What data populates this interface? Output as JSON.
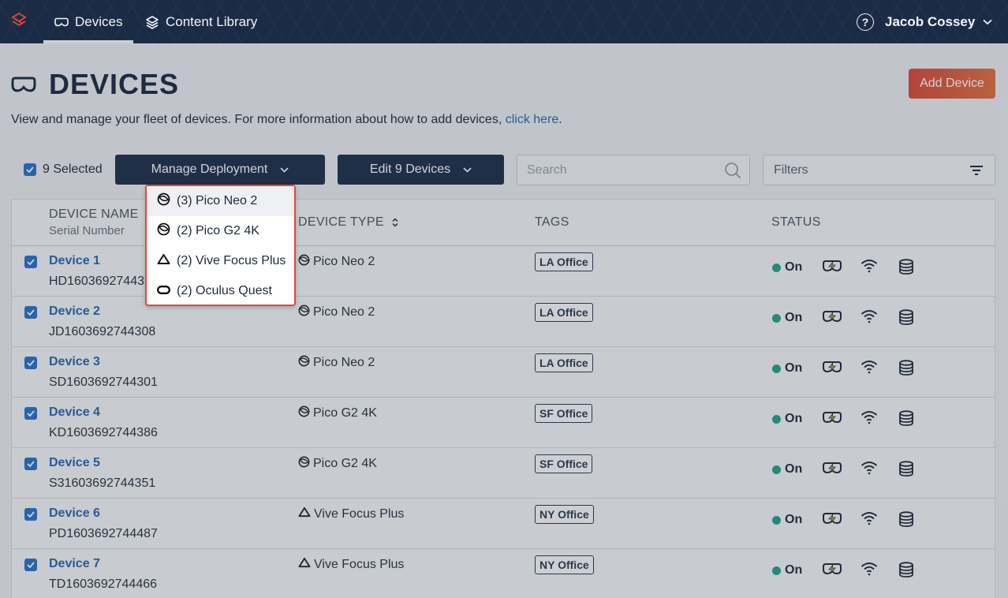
{
  "nav": {
    "devices_label": "Devices",
    "library_label": "Content Library",
    "help_label": "?",
    "user_name": "Jacob Cossey"
  },
  "page": {
    "title": "DEVICES",
    "intro_text": "View and manage your fleet of devices. For more information about how to add devices, ",
    "intro_link": "click here",
    "intro_end": ".",
    "add_device_label": "Add Device"
  },
  "toolbar": {
    "selected_label": "9 Selected",
    "manage_label": "Manage Deployment",
    "edit_label": "Edit 9 Devices",
    "search_placeholder": "Search",
    "filters_label": "Filters"
  },
  "table": {
    "col_name": "DEVICE NAME",
    "col_serial": "Serial Number",
    "col_type": "DEVICE TYPE",
    "col_tags": "TAGS",
    "col_status": "STATUS",
    "rows": [
      {
        "name": "Device 1",
        "serial": "HD1603692744399",
        "type": "Pico Neo 2",
        "type_icon": "pico-icon",
        "tag": "LA Office",
        "status": "On",
        "checked": true
      },
      {
        "name": "Device 2",
        "serial": "JD1603692744308",
        "type": "Pico Neo 2",
        "type_icon": "pico-icon",
        "tag": "LA Office",
        "status": "On",
        "checked": true
      },
      {
        "name": "Device 3",
        "serial": "SD1603692744301",
        "type": "Pico Neo 2",
        "type_icon": "pico-icon",
        "tag": "LA Office",
        "status": "On",
        "checked": true
      },
      {
        "name": "Device 4",
        "serial": "KD1603692744386",
        "type": "Pico G2 4K",
        "type_icon": "pico-icon",
        "tag": "SF Office",
        "status": "On",
        "checked": true
      },
      {
        "name": "Device 5",
        "serial": "S31603692744351",
        "type": "Pico G2 4K",
        "type_icon": "pico-icon",
        "tag": "SF Office",
        "status": "On",
        "checked": true
      },
      {
        "name": "Device 6",
        "serial": "PD1603692744487",
        "type": "Vive Focus Plus",
        "type_icon": "vive-icon",
        "tag": "NY Office",
        "status": "On",
        "checked": true
      },
      {
        "name": "Device 7",
        "serial": "TD1603692744466",
        "type": "Vive Focus Plus",
        "type_icon": "vive-icon",
        "tag": "NY Office",
        "status": "On",
        "checked": true
      }
    ]
  },
  "dropdown": {
    "items": [
      {
        "label": "(3) Pico Neo 2",
        "icon": "pico-icon"
      },
      {
        "label": "(2) Pico G2 4K",
        "icon": "pico-icon"
      },
      {
        "label": "(2) Vive Focus Plus",
        "icon": "vive-icon"
      },
      {
        "label": "(2) Oculus Quest",
        "icon": "oculus-icon"
      }
    ]
  },
  "colors": {
    "nav_bg": "#1c2b45",
    "accent_blue": "#2a66b1",
    "add_button": "#d94a3a",
    "status_on": "#20a38a",
    "dropdown_border": "#e0493c"
  }
}
